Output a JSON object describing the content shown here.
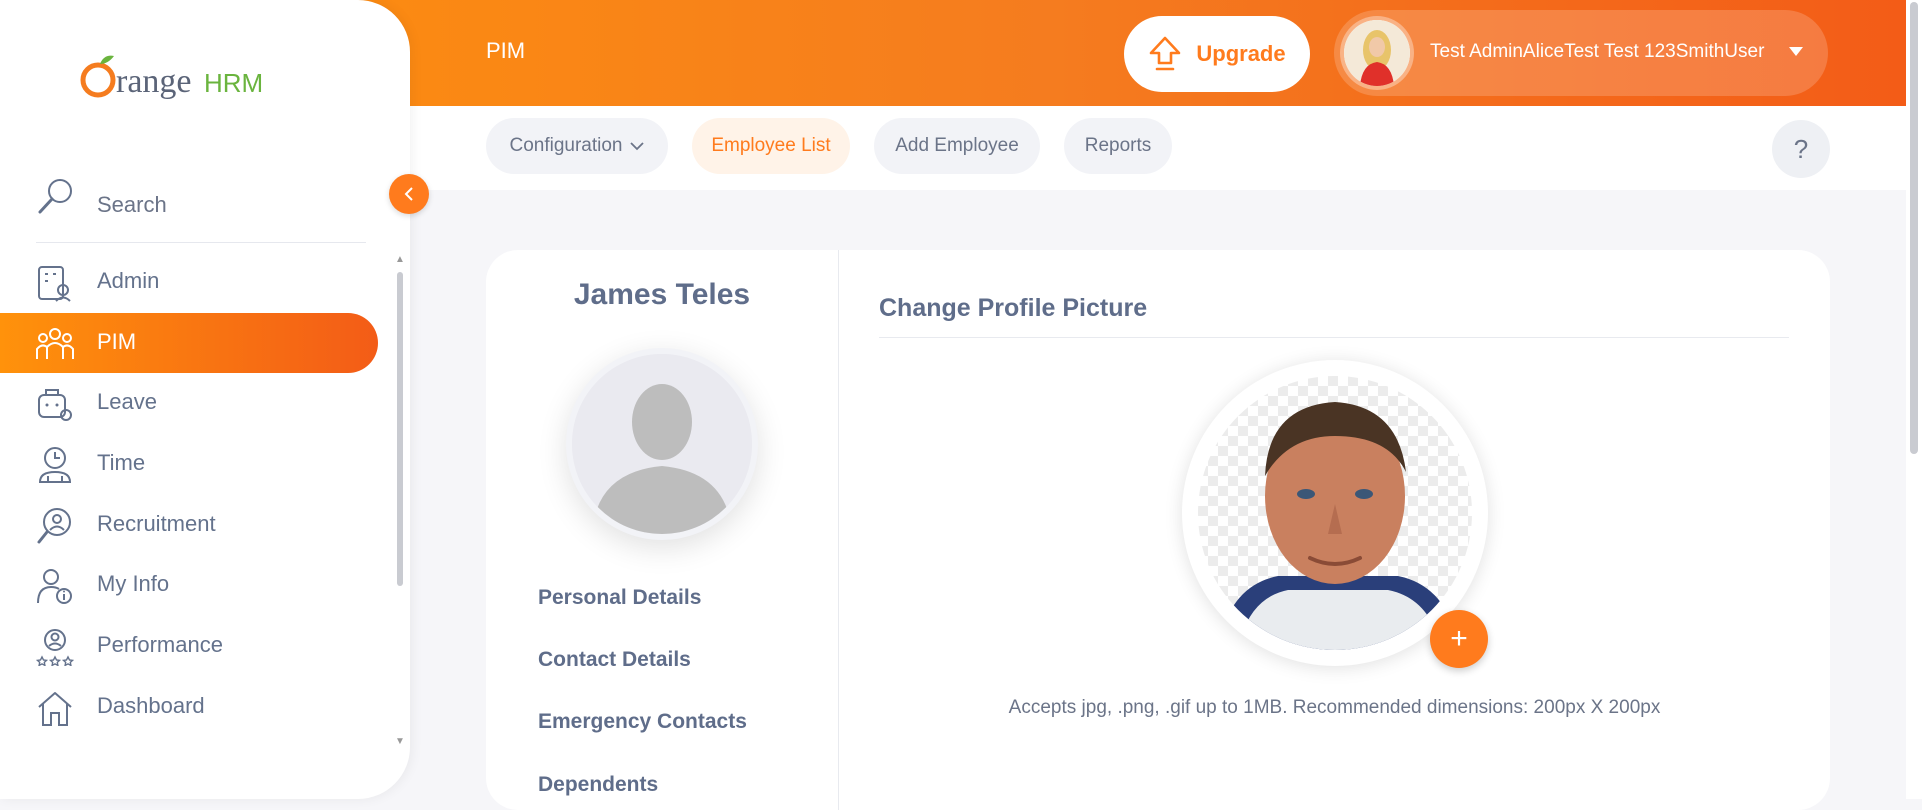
{
  "app": {
    "logo_text_orange": "Orange",
    "logo_text_hrm": "HRM"
  },
  "header": {
    "module_title": "PIM",
    "upgrade_label": "Upgrade",
    "user_name": "Test AdminAliceTest Test 123SmithUser"
  },
  "tabs": [
    {
      "label": "Configuration",
      "has_dropdown": true
    },
    {
      "label": "Employee List",
      "active": true
    },
    {
      "label": "Add Employee"
    },
    {
      "label": "Reports"
    }
  ],
  "help_label": "?",
  "sidebar": {
    "search_label": "Search",
    "items": [
      {
        "label": "Admin",
        "icon": "admin-icon"
      },
      {
        "label": "PIM",
        "icon": "pim-icon",
        "active": true
      },
      {
        "label": "Leave",
        "icon": "leave-icon"
      },
      {
        "label": "Time",
        "icon": "time-icon"
      },
      {
        "label": "Recruitment",
        "icon": "recruitment-icon"
      },
      {
        "label": "My Info",
        "icon": "my-info-icon"
      },
      {
        "label": "Performance",
        "icon": "performance-icon"
      },
      {
        "label": "Dashboard",
        "icon": "dashboard-icon"
      }
    ]
  },
  "employee": {
    "name": "James Teles",
    "links": [
      "Personal Details",
      "Contact Details",
      "Emergency Contacts",
      "Dependents"
    ]
  },
  "profile_picture": {
    "title": "Change Profile Picture",
    "add_label": "+",
    "hint": "Accepts jpg, .png, .gif up to 1MB. Recommended dimensions: 200px X 200px"
  },
  "colors": {
    "accent": "#ff7b1d",
    "text": "#64728c"
  }
}
